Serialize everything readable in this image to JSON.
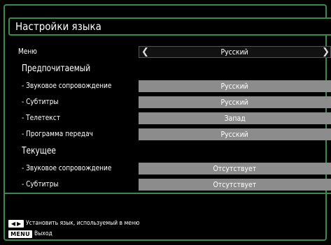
{
  "title": "Настройки языка",
  "menu": {
    "label": "Меню",
    "value": "Русский",
    "left_arrow": "❮",
    "right_arrow": "❯"
  },
  "preferred": {
    "heading": "Предпочитаемый",
    "rows": [
      {
        "label": "- Звуковое сопровождение",
        "value": "Русский"
      },
      {
        "label": "- Субтитры",
        "value": "Русский"
      },
      {
        "label": "- Телетекст",
        "value": "Запад"
      },
      {
        "label": "- Программа передач",
        "value": "Русский"
      }
    ]
  },
  "current": {
    "heading": "Текущее",
    "rows": [
      {
        "label": "- Звуковое сопровождение",
        "value": "Отсутствует"
      },
      {
        "label": "- Субтитры",
        "value": "Отсутствует"
      }
    ]
  },
  "footer": {
    "hint1": "Установить язык, используемый в меню",
    "hint2": "Выход",
    "key_menu": "MENU",
    "key_arrow_left": "◀",
    "key_arrow_right": "▶"
  },
  "colors": {
    "accent": "#3a8a4c",
    "value_bar": "#8c8c8c",
    "background": "#000000"
  }
}
